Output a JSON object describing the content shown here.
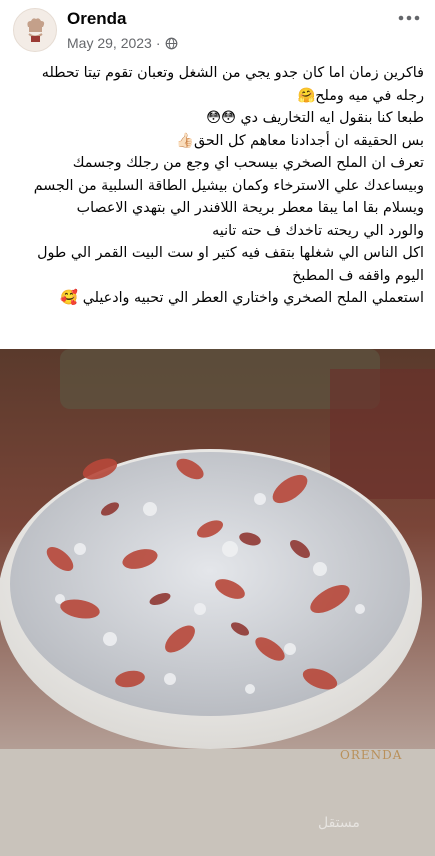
{
  "post": {
    "author": "Orenda",
    "date": "May 29, 2023",
    "separator": "·",
    "privacy_icon": "globe-icon",
    "more_icon": "more-options-icon",
    "lines": [
      "فاكرين زمان اما كان جدو يجي من الشغل وتعبان تقوم تيتا تحطله",
      "رجله في ميه وملح🤗",
      "طبعا كنا بنقول ايه التخاريف دي 😳😳",
      "بس الحقيقه ان أجدادنا معاهم كل الحق👍🏻",
      "تعرف ان الملح الصخري بيسحب اي وجع من رجلك وجسمك",
      "وبيساعدك علي الاسترخاء وكمان بيشيل الطاقة السلبية من الجسم",
      "ويسلام بقا اما يبقا معطر بريحة اللافندر الي بتهدي الاعصاب",
      "والورد الي ريحته تاخدك ف حته تانيه",
      "اكل الناس الي شغلها بتقف فيه كتير او ست البيت القمر الي طول",
      "اليوم واقفه ف المطبخ",
      "استعملي الملح الصخري واختاري العطر الي تحبيه وادعيلي 🥰"
    ]
  },
  "photo": {
    "watermark": "ORENDA",
    "site_mark": "مستقل"
  },
  "colors": {
    "meta_text": "#65676b",
    "text": "#050505",
    "salt": "#d9dce0",
    "petal": "#b8483a",
    "bowl": "#f4f4f2"
  }
}
